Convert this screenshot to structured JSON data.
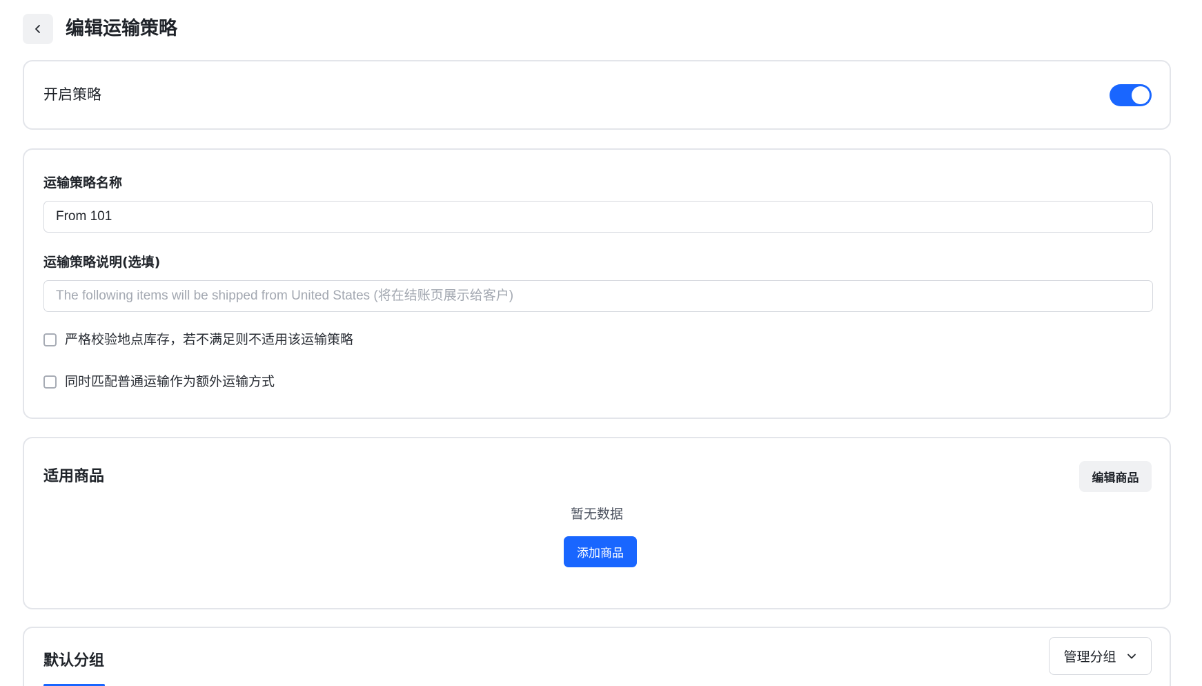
{
  "header": {
    "back_icon": "chevron-left-icon",
    "title": "编辑运输策略"
  },
  "enable_section": {
    "label": "开启策略",
    "toggle_on": true
  },
  "form": {
    "name_label": "运输策略名称",
    "name_value": "From 101",
    "description_label": "运输策略说明(选填)",
    "description_placeholder": "The following items will be shipped from United States (将在结账页展示给客户)",
    "checkbox_strict_inventory": {
      "label": "严格校验地点库存，若不满足则不适用该运输策略",
      "checked": false
    },
    "checkbox_match_standard": {
      "label": "同时匹配普通运输作为额外运输方式",
      "checked": false
    }
  },
  "products_section": {
    "title": "适用商品",
    "edit_button": "编辑商品",
    "empty_text": "暂无数据",
    "add_button": "添加商品"
  },
  "group_section": {
    "title": "默认分组",
    "manage_button": "管理分组",
    "manage_icon": "chevron-down-icon"
  },
  "colors": {
    "accent": "#1966ff",
    "border": "#e3e5ea",
    "button_bg": "#f0f1f3",
    "text": "#1f2329",
    "placeholder": "#a3a8b1"
  }
}
